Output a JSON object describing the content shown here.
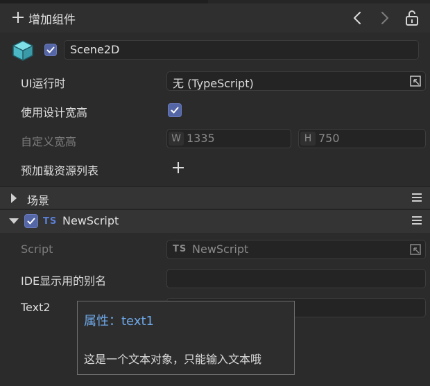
{
  "header": {
    "add_component_label": "增加组件"
  },
  "node": {
    "name": "Scene2D",
    "enabled": true
  },
  "properties": {
    "ui_runtime_label": "UI运行时",
    "ui_runtime_value": "无 (TypeScript)",
    "use_design_size_label": "使用设计宽高",
    "custom_size_label": "自定义宽高",
    "width_prefix": "W",
    "width_value": "1335",
    "height_prefix": "H",
    "height_value": "750",
    "preload_list_label": "预加载资源列表"
  },
  "sections": {
    "scene_title": "场景",
    "script_component_title": "NewScript",
    "ts_badge": "TS"
  },
  "script_component": {
    "script_label": "Script",
    "script_value": "NewScript",
    "ide_alias_label": "IDE显示用的别名",
    "text2_label": "Text2"
  },
  "tooltip": {
    "title": "属性：text1",
    "description": "这是一个文本对象，只能输入文本哦"
  },
  "colors": {
    "accent_checkbox": "#5566a6",
    "tooltip_title": "#6ea8e8",
    "ts_badge": "#5b7fd6"
  }
}
